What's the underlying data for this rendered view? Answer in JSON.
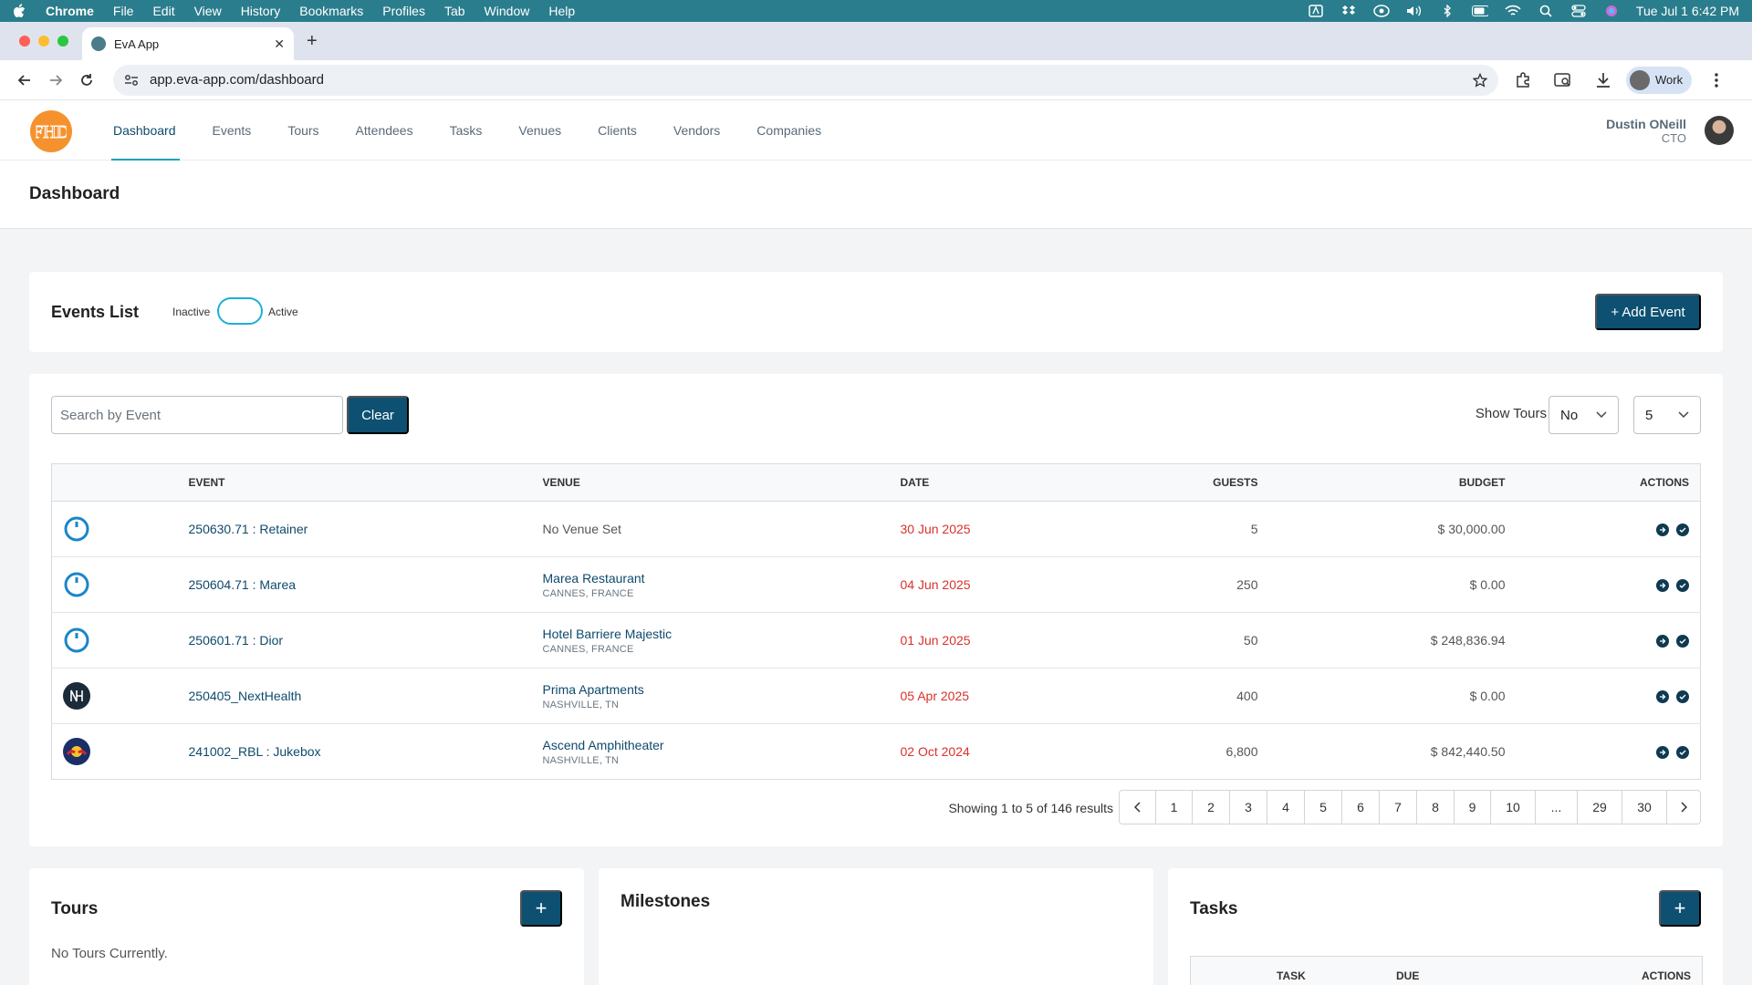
{
  "menubar": {
    "items": [
      "Chrome",
      "File",
      "Edit",
      "View",
      "History",
      "Bookmarks",
      "Profiles",
      "Tab",
      "Window",
      "Help"
    ],
    "clock": "Tue Jul 1  6:42 PM",
    "status_icons": [
      "adobe-icon",
      "dropbox-icon",
      "vpn-icon",
      "volume-icon",
      "bluetooth-icon",
      "battery-icon",
      "wifi-icon",
      "spotlight-icon",
      "control-center-icon",
      "siri-icon"
    ]
  },
  "browser": {
    "tab_title": "EvA App",
    "url": "app.eva-app.com/dashboard",
    "profile": "Work"
  },
  "app": {
    "logo_text": "FHD",
    "nav": [
      "Dashboard",
      "Events",
      "Tours",
      "Attendees",
      "Tasks",
      "Venues",
      "Clients",
      "Vendors",
      "Companies"
    ],
    "user_name": "Dustin ONeill",
    "user_role": "CTO"
  },
  "page": {
    "title": "Dashboard"
  },
  "events_list": {
    "title": "Events List",
    "toggle_left": "Inactive",
    "toggle_right": "Active",
    "add_button": "+ Add Event",
    "search_placeholder": "Search by Event",
    "clear_button": "Clear",
    "show_tours_label": "Show Tours",
    "show_tours_value": "No",
    "page_size_value": "5",
    "columns": [
      "EVENT",
      "VENUE",
      "DATE",
      "GUESTS",
      "BUDGET",
      "ACTIONS"
    ],
    "rows": [
      {
        "event": "250630.71 : Retainer",
        "venue": "No Venue Set",
        "location": "",
        "date": "30 Jun 2025",
        "guests": "5",
        "budget": "$ 30,000.00"
      },
      {
        "event": "250604.71 : Marea",
        "venue": "Marea Restaurant",
        "location": "CANNES, FRANCE",
        "date": "04 Jun 2025",
        "guests": "250",
        "budget": "$ 0.00"
      },
      {
        "event": "250601.71 : Dior",
        "venue": "Hotel Barriere Majestic",
        "location": "CANNES, FRANCE",
        "date": "01 Jun 2025",
        "guests": "50",
        "budget": "$ 248,836.94"
      },
      {
        "event": "250405_NextHealth",
        "venue": "Prima Apartments",
        "location": "NASHVILLE, TN",
        "date": "05 Apr 2025",
        "guests": "400",
        "budget": "$ 0.00"
      },
      {
        "event": "241002_RBL : Jukebox",
        "venue": "Ascend Amphitheater",
        "location": "NASHVILLE, TN",
        "date": "02 Oct 2024",
        "guests": "6,800",
        "budget": "$ 842,440.50"
      }
    ],
    "results_text": "Showing 1 to 5 of 146 results",
    "pages": [
      "1",
      "2",
      "3",
      "4",
      "5",
      "6",
      "7",
      "8",
      "9",
      "10",
      "...",
      "29",
      "30"
    ]
  },
  "tours": {
    "title": "Tours",
    "empty_text": "No Tours Currently.",
    "add_button": "+"
  },
  "milestones": {
    "title": "Milestones"
  },
  "tasks": {
    "title": "Tasks",
    "add_button": "+",
    "columns": [
      "TASK",
      "DUE",
      "ACTIONS"
    ]
  },
  "colors": {
    "menubar": "#2a7d8c",
    "primary": "#0e5072",
    "accent": "#1aa4b8",
    "date_red": "#d9312b",
    "logo_orange": "#f5922e"
  }
}
